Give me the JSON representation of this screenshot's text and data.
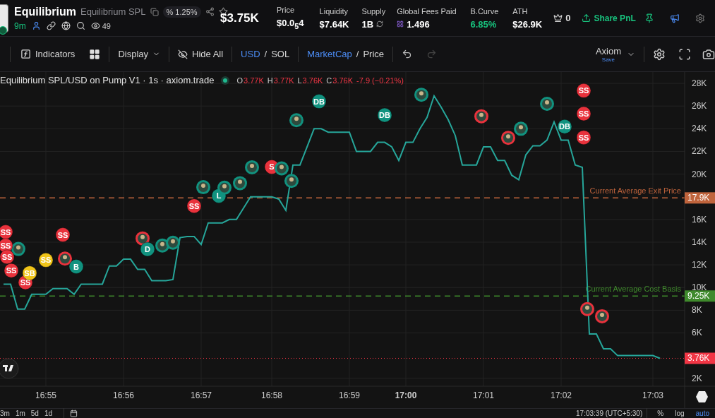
{
  "header": {
    "token_name": "Equilibrium",
    "token_full_name": "Equilibrium SPL",
    "change_chip": "% 1.25%",
    "age": "9m",
    "watchers": "49",
    "market_cap": "$3.75K",
    "stats": [
      {
        "label": "Price",
        "value": "$0.0$_{5}$4",
        "kind": "plain"
      },
      {
        "label": "Liquidity",
        "value": "$7.64K",
        "kind": "plain"
      },
      {
        "label": "Supply",
        "value": "1B",
        "kind": "refresh"
      },
      {
        "label": "Global Fees Paid",
        "value": "1.496",
        "kind": "sol"
      },
      {
        "label": "B.Curve",
        "value": "6.85%",
        "kind": "positive"
      },
      {
        "label": "ATH",
        "value": "$26.9K",
        "kind": "plain"
      }
    ],
    "crown_count": "0",
    "share_button": "Share PnL"
  },
  "toolbar": {
    "indicators": "Indicators",
    "display": "Display",
    "hide_all": "Hide All",
    "currency": {
      "separator": "/",
      "options": [
        {
          "label": "USD",
          "selected": true
        },
        {
          "label": "SOL",
          "selected": false
        }
      ]
    },
    "metric": {
      "separator": "/",
      "options": [
        {
          "label": "MarketCap",
          "selected": true
        },
        {
          "label": "Price",
          "selected": false
        }
      ]
    },
    "undo_disabled": false,
    "redo_disabled": true,
    "layout_name": "Axiom",
    "layout_save": "Save"
  },
  "chart": {
    "legend": {
      "title": "Equilibrium SPL/USD on Pump V1 · 1s · axiom.trade",
      "ohlc": [
        {
          "key": "O",
          "value": "3.77K"
        },
        {
          "key": "H",
          "value": "3.77K"
        },
        {
          "key": "L",
          "value": "3.76K"
        },
        {
          "key": "C",
          "value": "3.76K"
        }
      ],
      "change": "-7.9 (−0.21%)"
    },
    "chart_data": {
      "type": "line",
      "ylim": [
        1.3,
        29
      ],
      "grid": true,
      "ref_lines": [
        {
          "axis": "y",
          "value": 17.9,
          "label": "Current Average Exit Price",
          "color": "#c0643c"
        },
        {
          "axis": "y",
          "value": 9.25,
          "label": "Current Average Cost Basis",
          "color": "#3f8a2c"
        },
        {
          "axis": "y",
          "value": 3.76,
          "color": "#f23645"
        }
      ],
      "categories": [
        null,
        null,
        null,
        null,
        null,
        null,
        "16:55",
        null,
        null,
        null,
        null,
        null,
        null,
        null,
        null,
        null,
        null,
        "16:56",
        null,
        null,
        null,
        null,
        null,
        null,
        null,
        null,
        null,
        null,
        "16:57",
        null,
        null,
        null,
        null,
        null,
        null,
        null,
        null,
        null,
        "16:58",
        null,
        null,
        null,
        null,
        null,
        null,
        null,
        null,
        null,
        null,
        "16:59",
        null,
        null,
        null,
        null,
        null,
        null,
        null,
        "17:00",
        null,
        null,
        null,
        null,
        null,
        null,
        null,
        null,
        null,
        null,
        "17:01",
        null,
        null,
        null,
        null,
        null,
        null,
        null,
        null,
        null,
        null,
        "17:02",
        null,
        null,
        null,
        null,
        null,
        null,
        null,
        null,
        null,
        null,
        null,
        null,
        "17:03",
        null,
        null,
        null,
        null
      ],
      "series": [
        {
          "color": "#26a69a",
          "values": [
            10.3,
            10.3,
            8.1,
            8.1,
            9.4,
            9.4,
            9.4,
            9.9,
            9.9,
            9.9,
            9.4,
            10.3,
            10.3,
            10.3,
            10.3,
            11.9,
            11.9,
            12.5,
            12.5,
            11.6,
            11.6,
            10.6,
            10.6,
            10.6,
            10.7,
            14.4,
            14.5,
            14.5,
            13.8,
            15.7,
            15.7,
            15.7,
            16.0,
            16.0,
            17.0,
            18.0,
            18.0,
            18.0,
            18.0,
            17.8,
            16.8,
            20.8,
            20.8,
            22.4,
            24.0,
            24.0,
            23.7,
            23.7,
            23.7,
            23.7,
            22.0,
            22.0,
            22.0,
            22.8,
            22.8,
            22.4,
            21.2,
            22.8,
            22.8,
            24.0,
            25.0,
            26.9,
            25.9,
            24.8,
            23.4,
            20.8,
            20.8,
            20.8,
            22.4,
            22.4,
            21.2,
            21.2,
            19.9,
            19.5,
            21.7,
            22.5,
            22.5,
            23.0,
            24.6,
            23.0,
            23.0,
            20.8,
            20.6,
            5.9,
            5.9,
            4.6,
            4.6,
            4.0,
            4.0,
            4.0,
            4.0,
            4.0,
            4.0,
            3.76,
            null,
            null,
            null
          ]
        }
      ],
      "yticks": [
        {
          "value": 2,
          "label": "2K"
        },
        {
          "value": 6,
          "label": "6K"
        },
        {
          "value": 8,
          "label": "8K"
        },
        {
          "value": 10,
          "label": "10K"
        },
        {
          "value": 12,
          "label": "12K"
        },
        {
          "value": 14,
          "label": "14K"
        },
        {
          "value": 16,
          "label": "16K"
        },
        {
          "value": 20,
          "label": "20K"
        },
        {
          "value": 22,
          "label": "22K"
        },
        {
          "value": 24,
          "label": "24K"
        },
        {
          "value": 26,
          "label": "26K"
        },
        {
          "value": 28,
          "label": "28K"
        }
      ]
    },
    "overlays": [
      {
        "kind": "badge",
        "label": "17.9K",
        "color": "#c0643c"
      },
      {
        "kind": "badge",
        "label": "9.25K",
        "color": "#3f8a2c"
      },
      {
        "kind": "badge",
        "label": "3.76K",
        "color": "#f23645"
      },
      {
        "kind": "avatar",
        "color": "#11927f"
      },
      {
        "kind": "marker",
        "text": "SS",
        "color": "#e8323c"
      },
      {
        "kind": "marker",
        "text": "SS",
        "color": "#e8323c"
      },
      {
        "kind": "marker",
        "text": "SS",
        "color": "#e8323c"
      },
      {
        "kind": "marker",
        "text": "SS",
        "color": "#e8323c"
      },
      {
        "kind": "marker",
        "text": "SS",
        "color": "#e8323c"
      },
      {
        "kind": "marker",
        "text": "SB",
        "color": "#f0c419"
      },
      {
        "kind": "marker",
        "text": "SS",
        "color": "#f0c419"
      },
      {
        "kind": "marker",
        "text": "SS",
        "color": "#e8323c"
      },
      {
        "kind": "avatar",
        "color": "#e8323c"
      },
      {
        "kind": "marker",
        "text": "B",
        "color": "#11927f"
      },
      {
        "kind": "avatar",
        "color": "#e8323c"
      },
      {
        "kind": "marker",
        "text": "D",
        "color": "#11927f"
      },
      {
        "kind": "avatar",
        "color": "#11927f"
      },
      {
        "kind": "avatar",
        "color": "#11927f"
      },
      {
        "kind": "marker",
        "text": "SS",
        "color": "#e8323c"
      },
      {
        "kind": "avatar",
        "color": "#11927f"
      },
      {
        "kind": "marker",
        "text": "L",
        "color": "#11927f"
      },
      {
        "kind": "avatar",
        "color": "#11927f"
      },
      {
        "kind": "avatar",
        "color": "#11927f"
      },
      {
        "kind": "avatar",
        "color": "#11927f"
      },
      {
        "kind": "marker",
        "text": "S",
        "color": "#e8323c"
      },
      {
        "kind": "avatar",
        "color": "#11927f"
      },
      {
        "kind": "avatar",
        "color": "#11927f"
      },
      {
        "kind": "avatar",
        "color": "#11927f"
      },
      {
        "kind": "marker",
        "text": "DB",
        "color": "#11927f"
      },
      {
        "kind": "marker",
        "text": "DB",
        "color": "#11927f"
      },
      {
        "kind": "avatar",
        "color": "#11927f"
      },
      {
        "kind": "avatar",
        "color": "#e8323c"
      },
      {
        "kind": "avatar",
        "color": "#e8323c"
      },
      {
        "kind": "avatar",
        "color": "#11927f"
      },
      {
        "kind": "avatar",
        "color": "#11927f"
      },
      {
        "kind": "marker",
        "text": "DB",
        "color": "#11927f"
      },
      {
        "kind": "marker",
        "text": "SS",
        "color": "#e8323c"
      },
      {
        "kind": "marker",
        "text": "SS",
        "color": "#e8323c"
      },
      {
        "kind": "marker",
        "text": "SS",
        "color": "#e8323c"
      },
      {
        "kind": "avatar",
        "color": "#e8323c"
      },
      {
        "kind": "avatar",
        "color": "#e8323c"
      }
    ]
  },
  "bottom_bar": {
    "ranges": [
      "3m",
      "1m",
      "5d",
      "1d"
    ],
    "clock": "17:03:39 (UTC+5:30)",
    "options": [
      {
        "label": "%",
        "selected": false
      },
      {
        "label": "log",
        "selected": false
      },
      {
        "label": "auto",
        "selected": true
      }
    ]
  }
}
